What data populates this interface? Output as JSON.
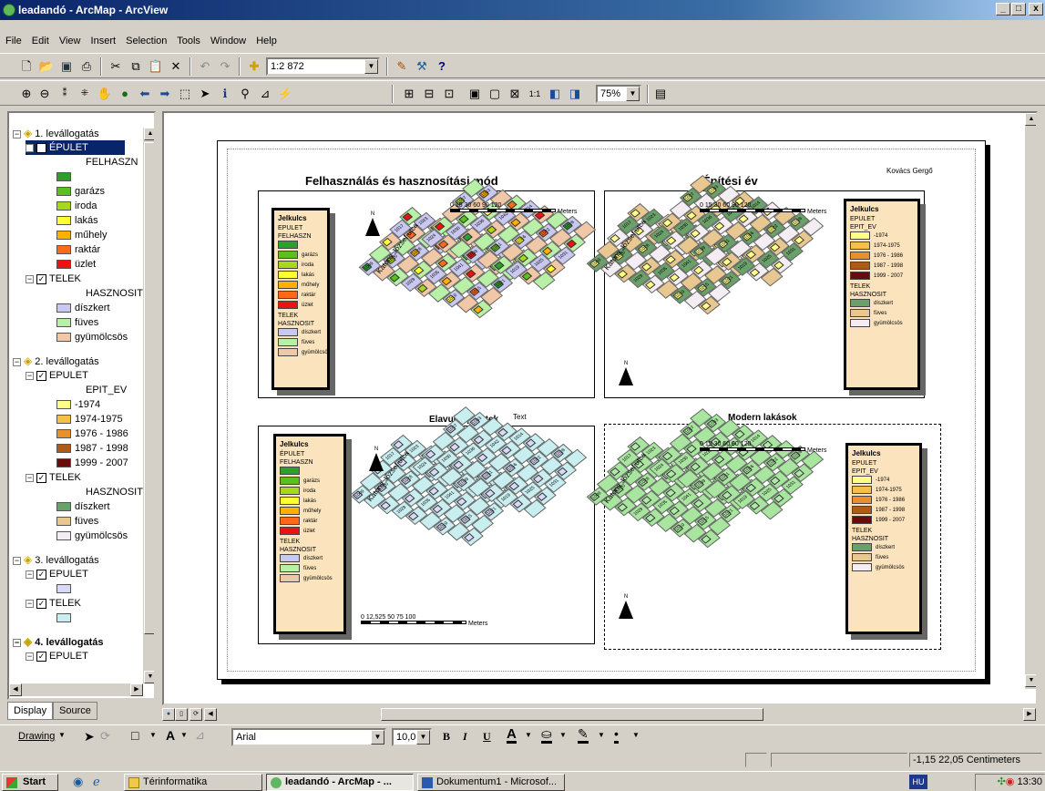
{
  "window": {
    "title": "leadandó - ArcMap - ArcView",
    "min": "_",
    "max": "□",
    "close": "x"
  },
  "menu": [
    "File",
    "Edit",
    "View",
    "Insert",
    "Selection",
    "Tools",
    "Window",
    "Help"
  ],
  "toolbar": {
    "scale": "1:2 872",
    "zoom": "75%"
  },
  "toc": {
    "groups": [
      {
        "name": "1. levállogatás",
        "layers": [
          {
            "name": "ÉPULET",
            "field": "FELHASZN",
            "items": [
              {
                "label": "",
                "color": "#2e9e2e"
              },
              {
                "label": "garázs",
                "color": "#5cbf1f"
              },
              {
                "label": "iroda",
                "color": "#a8d81a"
              },
              {
                "label": "lakás",
                "color": "#ffff33"
              },
              {
                "label": "műhely",
                "color": "#ffb000"
              },
              {
                "label": "raktár",
                "color": "#ff6a1a"
              },
              {
                "label": "üzlet",
                "color": "#ee1111"
              }
            ]
          },
          {
            "name": "TELEK",
            "field": "HASZNOSIT",
            "items": [
              {
                "label": "díszkert",
                "color": "#c8c8f0"
              },
              {
                "label": "füves",
                "color": "#b8f0a8"
              },
              {
                "label": "gyümölcsös",
                "color": "#f0c8a8"
              }
            ]
          }
        ]
      },
      {
        "name": "2. levállogatás",
        "layers": [
          {
            "name": "EPULET",
            "field": "EPIT_EV",
            "items": [
              {
                "label": "-1974",
                "color": "#ffff88"
              },
              {
                "label": "1974-1975",
                "color": "#f5c048"
              },
              {
                "label": "1976 - 1986",
                "color": "#e8902a"
              },
              {
                "label": "1987 - 1998",
                "color": "#b05a1a"
              },
              {
                "label": "1999 - 2007",
                "color": "#6a0a0a"
              }
            ]
          },
          {
            "name": "TELEK",
            "field": "HASZNOSIT",
            "items": [
              {
                "label": "díszkert",
                "color": "#6aa06a"
              },
              {
                "label": "füves",
                "color": "#e8c890"
              },
              {
                "label": "gyümölcsös",
                "color": "#f4eef4"
              }
            ]
          }
        ]
      },
      {
        "name": "3. levállogatás",
        "layers": [
          {
            "name": "EPULET",
            "field": "",
            "items": [
              {
                "label": "",
                "color": "#d8d8f8"
              }
            ]
          },
          {
            "name": "TELEK",
            "field": "",
            "items": [
              {
                "label": "",
                "color": "#c8eef0"
              }
            ]
          }
        ]
      },
      {
        "name": "4. levállogatás",
        "layers": [
          {
            "name": "EPULET",
            "field": "",
            "items": []
          }
        ]
      }
    ]
  },
  "tabs": {
    "display": "Display",
    "source": "Source"
  },
  "layout": {
    "author": "Kovács Gergő",
    "maps": [
      {
        "title": "Felhasználás és hasznosítási mód",
        "street": "Katona József utca",
        "scale": "0  15 30     60      90      120",
        "units": "Meters",
        "north": "N",
        "legend": {
          "head": "Jelkulcs",
          "l1": "EPULET",
          "f1": "FELHASZN",
          "items1": [
            "",
            "garázs",
            "iroda",
            "lakás",
            "műhely",
            "raktár",
            "üzlet"
          ],
          "l2": "TELEK",
          "f2": "HASZNOSIT",
          "items2": [
            "díszkert",
            "füves",
            "gyümölcsös"
          ]
        }
      },
      {
        "title": "Építési év",
        "street": "Katona József utca",
        "scale": "0  15 30     60      90    120",
        "units": "Meters",
        "north": "N",
        "legend": {
          "head": "Jelkulcs",
          "l1": "EPULET",
          "f1": "EPIT_EV",
          "items1": [
            "-1974",
            "1974-1975",
            "1976 - 1986",
            "1987 - 1998",
            "1999 - 2007"
          ],
          "l2": "TELEK",
          "f2": "HASZNOSIT",
          "items2": [
            "díszkert",
            "füves",
            "gyümölcsös"
          ]
        }
      },
      {
        "title": "Elavult épületek",
        "extra": "Text",
        "street": "Katona József utca",
        "scale": "0 12,525   50     75    100",
        "units": "Meters",
        "north": "N",
        "legend": {
          "head": "Jelkulcs",
          "l1": "ÉPULET",
          "f1": "FELHASZN",
          "items1": [
            "",
            "garázs",
            "iroda",
            "lakás",
            "műhely",
            "raktár",
            "üzlet"
          ],
          "l2": "TELEK",
          "f2": "HASZNOSIT",
          "items2": [
            "díszkert",
            "füves",
            "gyümölcsös"
          ]
        }
      },
      {
        "title": "Modern lakások",
        "street": "Katona József utca",
        "scale": "0  15 30     60      90    120",
        "units": "Meters",
        "north": "N",
        "legend": {
          "head": "Jelkulcs",
          "l1": "EPULET",
          "f1": "EPIT_EV",
          "items1": [
            "-1974",
            "1974-1975",
            "1976 - 1986",
            "1987 - 1998",
            "1999 - 2007"
          ],
          "l2": "TELEK",
          "f2": "HASZNOSIT",
          "items2": [
            "díszkert",
            "füves",
            "gyümölcsös"
          ]
        }
      }
    ],
    "parcel_ids": [
      "1009",
      "1015",
      "1016",
      "1017",
      "1018",
      "1019",
      "1020",
      "1021",
      "1022",
      "1023",
      "1024",
      "1025",
      "1026",
      "1027",
      "1028",
      "1029",
      "1030",
      "1031",
      "1032",
      "1033",
      "1034",
      "1035",
      "1036",
      "1037",
      "1038",
      "1039",
      "1040",
      "1041",
      "1042",
      "1043",
      "1010",
      "1011",
      "1012",
      "1013",
      "1014"
    ]
  },
  "drawing": {
    "label": "Drawing",
    "font": "Arial",
    "size": "10,0",
    "bold": "B",
    "italic": "I",
    "underline": "U"
  },
  "status": {
    "coords": "-1,15  22,05 Centimeters"
  },
  "taskbar": {
    "start": "Start",
    "items": [
      "Térinformatika",
      "leadandó - ArcMap - ...",
      "Dokumentum1 - Microsof..."
    ],
    "lang": "HU",
    "clock": "13:30"
  }
}
